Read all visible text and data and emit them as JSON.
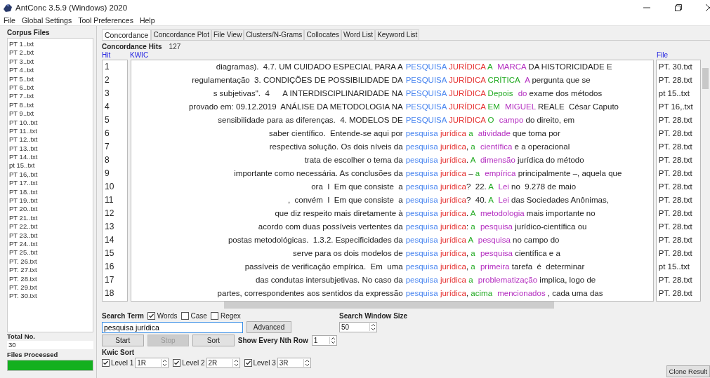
{
  "window": {
    "title": "AntConc 3.5.9 (Windows) 2020"
  },
  "menu": [
    "File",
    "Global Settings",
    "Tool Preferences",
    "Help"
  ],
  "corpus": {
    "heading": "Corpus Files",
    "files": [
      "PT 1..txt",
      "PT 2..txt",
      "PT 3..txt",
      "PT 4..txt",
      "PT 5..txt",
      "PT 6..txt",
      "PT 7..txt",
      "PT 8..txt",
      "PT 9..txt",
      "PT 10..txt",
      "PT 11..txt",
      "PT 12..txt",
      "PT 13..txt",
      "PT 14..txt",
      "pt 15..txt",
      "PT 16,.txt",
      "PT 17..txt",
      "PT 18..txt",
      "PT 19..txt",
      "PT 20..txt",
      "PT 21..txt",
      "PT 22..txt",
      "PT 23..txt",
      "PT 24..txt",
      "PT 25..txt",
      "PT. 26.txt",
      "PT. 27.txt",
      "PT. 28.txt",
      "PT. 29.txt",
      "PT. 30.txt"
    ],
    "total_label": "Total No.",
    "total": "30",
    "processed_label": "Files Processed",
    "progress": {
      "level": 1
    }
  },
  "tabs": [
    {
      "label": "Concordance",
      "selected": true
    },
    {
      "label": "Concordance Plot",
      "selected": false
    },
    {
      "label": "File View",
      "selected": false
    },
    {
      "label": "Clusters/N-Grams",
      "selected": false
    },
    {
      "label": "Collocates",
      "selected": false
    },
    {
      "label": "Word List",
      "selected": false
    },
    {
      "label": "Keyword List",
      "selected": false
    }
  ],
  "hits": {
    "label": "Concordance Hits",
    "count": "127"
  },
  "table": {
    "columns": [
      "Hit",
      "KWIC",
      "File"
    ],
    "rows": [
      {
        "hit": "1",
        "left": "diagramas).  4.7. UM CUIDADO ESPECIAL PARA A",
        "node": [
          "PESQUISA",
          "JURÍDICA"
        ],
        "r1": "A",
        "r2": "MARCA",
        "rest": "DA HISTORICIDADE E",
        "file": "PT. 30.txt"
      },
      {
        "hit": "2",
        "left": "regulamentação  3. CONDIÇÕES DE POSSIBILIDADE DA",
        "node": [
          "PESQUISA",
          "JURÍDICA"
        ],
        "r1": "CRÍTICA",
        "r2": "A",
        "rest": "pergunta que se",
        "file": "PT. 28.txt"
      },
      {
        "hit": "3",
        "left": "s subjetivas\".  4      A INTERDISCIPLINARIDADE NA",
        "node": [
          "PESQUISA",
          "JURÍDICA"
        ],
        "r1": "Depois",
        "r2": "do",
        "rest": "exame dos métodos",
        "file": "pt 15..txt"
      },
      {
        "hit": "4",
        "left": "provado em: 09.12.2019  ANÁLISE DA METODOLOGIA NA",
        "node": [
          "PESQUISA",
          "JURÍDICA"
        ],
        "r1": "EM",
        "r2": "MIGUEL",
        "rest": "REALE  César Caputo",
        "file": "PT 16,.txt"
      },
      {
        "hit": "5",
        "left": "sensibilidade para as diferenças.  4. MODELOS DE",
        "node": [
          "PESQUISA",
          "JURÍDICA"
        ],
        "r1": "O",
        "r2": "campo",
        "rest": "do direito, em",
        "file": "PT. 28.txt"
      },
      {
        "hit": "6",
        "left": "saber científico.  Entende-se aqui por",
        "node": [
          "pesquisa",
          "jurídica"
        ],
        "r1": "a",
        "r2": "atividade",
        "rest": "que toma por",
        "file": "PT. 28.txt"
      },
      {
        "hit": "7",
        "left": "respectiva solução. Os dois níveis da",
        "node": [
          "pesquisa",
          "jurídica"
        ],
        "after": ",",
        "r1": "a",
        "r2": "científica",
        "rest": "e a operacional",
        "file": "PT. 28.txt"
      },
      {
        "hit": "8",
        "left": "trata de escolher o tema da",
        "node": [
          "pesquisa",
          "jurídica"
        ],
        "after": ".",
        "r1": "A",
        "r2": "dimensão",
        "rest": "jurídica do método",
        "file": "PT. 28.txt"
      },
      {
        "hit": "9",
        "left": "importante como necessária. As conclusões da",
        "node": [
          "pesquisa",
          "jurídica"
        ],
        "after": " –",
        "r1": "a",
        "r2": "empírica",
        "rest": "principalmente –, aquela que",
        "file": "PT. 28.txt"
      },
      {
        "hit": "10",
        "left": "ora  I  Em que consiste  a",
        "node": [
          "pesquisa",
          "jurídica"
        ],
        "after": "?  22.",
        "r1": "A",
        "r2": "Lei",
        "rest": "no  9.278 de maio",
        "file": "PT. 28.txt"
      },
      {
        "hit": "11",
        "left": ",  convém  I  Em que consiste  a",
        "node": [
          "pesquisa",
          "jurídica"
        ],
        "after": "?  40.",
        "r1": "A",
        "r2": "Lei",
        "rest": "das Sociedades Anônimas,",
        "file": "PT. 28.txt"
      },
      {
        "hit": "12",
        "left": "que diz respeito mais diretamente à",
        "node": [
          "pesquisa",
          "jurídica"
        ],
        "after": ".",
        "r1": "A",
        "r2": "metodologia",
        "rest": "mais importante no",
        "file": "PT. 28.txt"
      },
      {
        "hit": "13",
        "left": "acordo com duas possíveis vertentes da",
        "node": [
          "pesquisa",
          "jurídica"
        ],
        "after": ":",
        "r1": "a",
        "r2": "pesquisa",
        "rest": "jurídico-científica ou",
        "file": "PT. 28.txt"
      },
      {
        "hit": "14",
        "left": "postas metodológicas.  1.3.2. Especificidades da",
        "node": [
          "pesquisa",
          "jurídica"
        ],
        "r1": "A",
        "r2": "pesquisa",
        "rest": "no campo do",
        "file": "PT. 28.txt"
      },
      {
        "hit": "15",
        "left": "serve para os dois modelos de",
        "node": [
          "pesquisa",
          "jurídica"
        ],
        "after": ",",
        "r1": "a",
        "r2": "pesquisa",
        "rest": "científica e a",
        "file": "PT. 28.txt"
      },
      {
        "hit": "16",
        "left": "passíveis de verificação empírica.  Em  uma",
        "node": [
          "pesquisa",
          "jurídica"
        ],
        "after": ",",
        "r1": "a",
        "r2": "primeira",
        "rest": "tarefa  é  determinar",
        "file": "pt 15..txt"
      },
      {
        "hit": "17",
        "left": "das condutas intersubjetivas. No caso da",
        "node": [
          "pesquisa",
          "jurídica"
        ],
        "r1": "a",
        "r2": "problematização",
        "rest": "implica, logo de",
        "file": "PT. 28.txt"
      },
      {
        "hit": "18",
        "left": "partes, correspondentes aos sentidos da expressão",
        "node": [
          "pesquisa",
          "jurídica"
        ],
        "after": ",",
        "r1": "acima",
        "r2": "mencionados",
        "rest": ", cada uma das",
        "file": "PT. 28.txt"
      }
    ]
  },
  "search": {
    "label": "Search Term",
    "options": [
      {
        "label": "Words",
        "checked": true
      },
      {
        "label": "Case",
        "checked": false
      },
      {
        "label": "Regex",
        "checked": false
      }
    ],
    "value": "pesquisa jurídica",
    "advanced": "Advanced",
    "window_size_label": "Search Window Size",
    "window_size": "50"
  },
  "actions": [
    {
      "label": "Start",
      "disabled": false
    },
    {
      "label": "Stop",
      "disabled": true
    },
    {
      "label": "Sort",
      "disabled": false
    }
  ],
  "nth_row": {
    "label": "Show Every Nth Row",
    "value": "1"
  },
  "kwic_sort": {
    "label": "Kwic Sort",
    "levels": [
      {
        "label": "Level 1",
        "checked": true,
        "value": "1R"
      },
      {
        "label": "Level 2",
        "checked": true,
        "value": "2R"
      },
      {
        "label": "Level 3",
        "checked": true,
        "value": "3R"
      }
    ]
  },
  "clone": "Clone Result"
}
